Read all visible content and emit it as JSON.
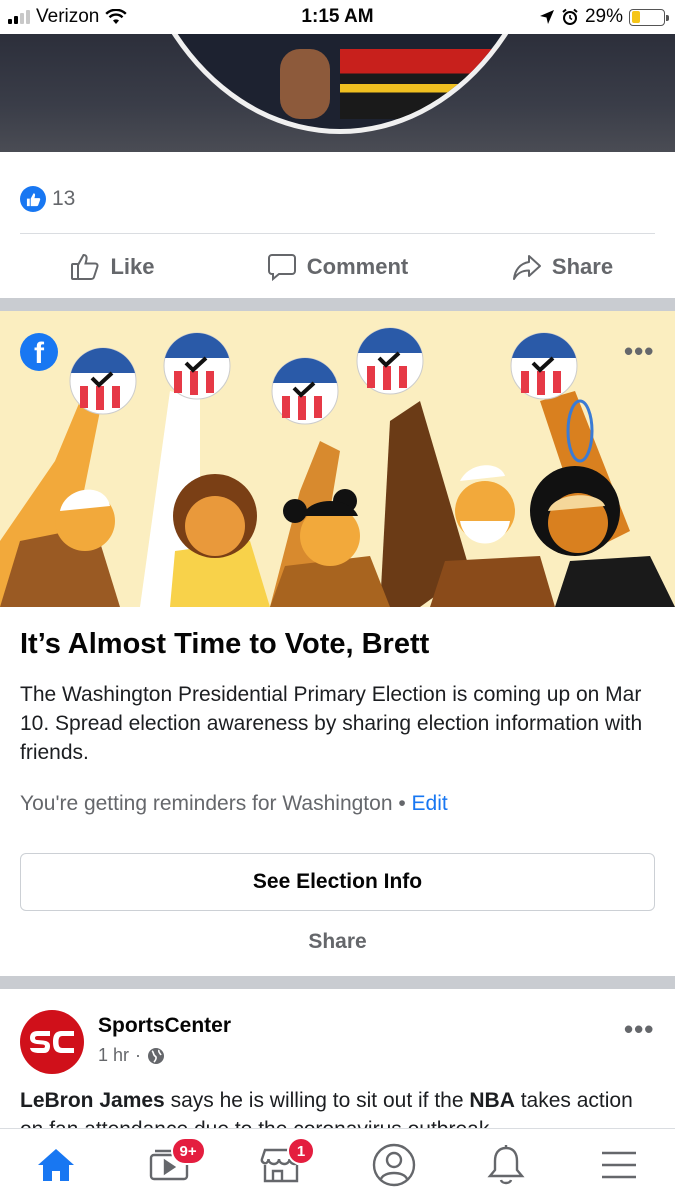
{
  "status_bar": {
    "carrier": "Verizon",
    "time": "1:15 AM",
    "battery_percent": "29%",
    "battery_level": 0.29
  },
  "previous_post": {
    "reaction_count": "13",
    "actions": {
      "like": "Like",
      "comment": "Comment",
      "share": "Share"
    }
  },
  "election_card": {
    "title": "It’s Almost Time to Vote, Brett",
    "body": "The Washington Presidential Primary Election is coming up on Mar 10. Spread election awareness by sharing election information with friends.",
    "reminder_text": "You're getting reminders for Washington",
    "reminder_separator": "•",
    "edit_label": "Edit",
    "button_label": "See Election Info",
    "share_label": "Share"
  },
  "sports_post": {
    "page_name": "SportsCenter",
    "time": "1 hr",
    "meta_separator": "·",
    "text_parts": [
      {
        "text": "LeBron James",
        "bold": true
      },
      {
        "text": " says he is willing to sit out if the ",
        "bold": false
      },
      {
        "text": "NBA",
        "bold": true
      },
      {
        "text": " takes action on fan attendance due to the coronavirus outbreak",
        "bold": false
      }
    ]
  },
  "tab_bar": {
    "tabs": [
      {
        "icon": "home-icon",
        "active": true,
        "badge": ""
      },
      {
        "icon": "watch-icon",
        "active": false,
        "badge": "9+"
      },
      {
        "icon": "marketplace-icon",
        "active": false,
        "badge": "1"
      },
      {
        "icon": "profile-icon",
        "active": false,
        "badge": ""
      },
      {
        "icon": "bell-icon",
        "active": false,
        "badge": ""
      },
      {
        "icon": "menu-icon",
        "active": false,
        "badge": ""
      }
    ]
  },
  "colors": {
    "facebook_blue": "#1877f2",
    "badge_red": "#e41e3f",
    "banner_bg": "#fbeec0",
    "espn_red": "#d0101a",
    "muted_text": "#65676b"
  }
}
